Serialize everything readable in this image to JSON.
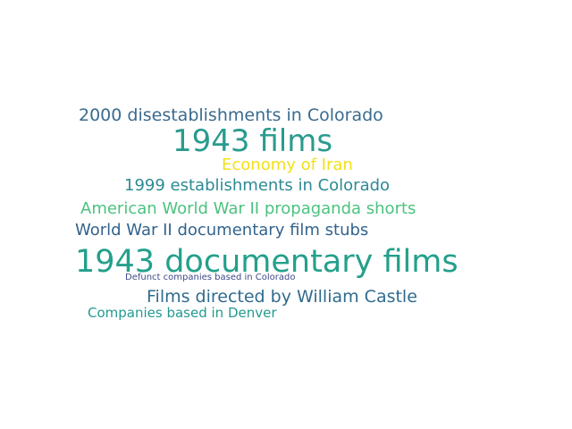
{
  "word_cloud": {
    "words": [
      {
        "text": "2000 disestablishments in Colorado",
        "color": "#3a6b8f"
      },
      {
        "text": "1943 films",
        "color": "#2a9b8e"
      },
      {
        "text": "Economy of Iran",
        "color": "#f2e01a"
      },
      {
        "text": "1999 establishments in Colorado",
        "color": "#2d8a93"
      },
      {
        "text": "American World War II propaganda shorts",
        "color": "#4cc27f"
      },
      {
        "text": "World War II documentary film stubs",
        "color": "#33638d"
      },
      {
        "text": "1943 documentary films",
        "color": "#23a08b"
      },
      {
        "text": "Defunct companies based in Colorado",
        "color": "#3f4a8a"
      },
      {
        "text": "Films directed by William Castle",
        "color": "#2f6b8e"
      },
      {
        "text": "Companies based in Denver",
        "color": "#239a8f"
      }
    ]
  }
}
